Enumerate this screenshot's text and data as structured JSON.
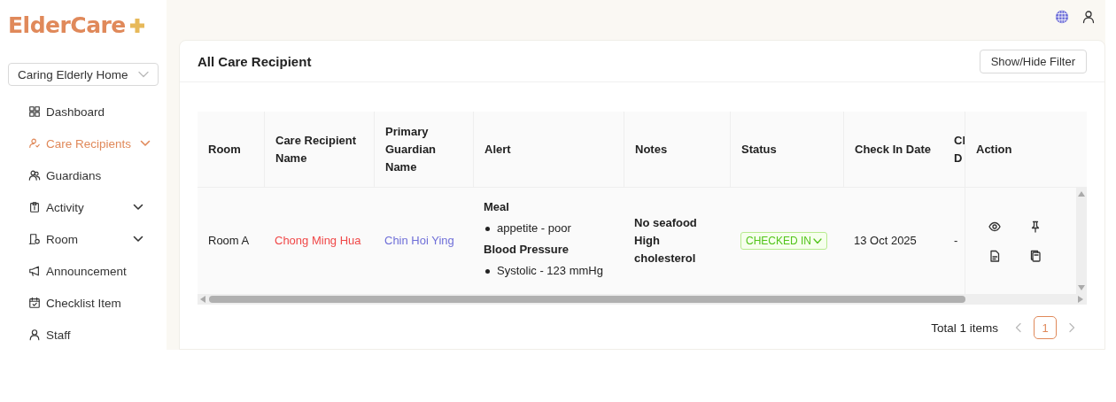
{
  "brand": {
    "name": "ElderCare"
  },
  "home_select": {
    "value": "Caring Elderly Home"
  },
  "sidebar": {
    "items": [
      {
        "label": "Dashboard",
        "selected": false,
        "submenu": false
      },
      {
        "label": "Care Recipients",
        "selected": true,
        "submenu": true
      },
      {
        "label": "Guardians",
        "selected": false,
        "submenu": false
      },
      {
        "label": "Activity",
        "selected": false,
        "submenu": true
      },
      {
        "label": "Room",
        "selected": false,
        "submenu": true
      },
      {
        "label": "Announcement",
        "selected": false,
        "submenu": false
      },
      {
        "label": "Checklist Item",
        "selected": false,
        "submenu": false
      },
      {
        "label": "Staff",
        "selected": false,
        "submenu": false
      }
    ]
  },
  "card": {
    "title": "All Care Recipient",
    "filter_button": "Show/Hide Filter"
  },
  "table": {
    "columns": [
      "Room",
      "Care Recipient Name",
      "Primary Guardian Name",
      "Alert",
      "Notes",
      "Status",
      "Check In Date",
      "Cl D",
      "Action"
    ],
    "rows": [
      {
        "room": "Room A",
        "name": "Chong Ming Hua",
        "guardian": "Chin Hoi Ying",
        "alerts": [
          {
            "title": "Meal",
            "items": [
              "appetite - poor"
            ]
          },
          {
            "title": "Blood Pressure",
            "items": [
              "Systolic - 123 mmHg"
            ]
          }
        ],
        "notes": [
          "No seafood",
          "High cholesterol"
        ],
        "status": {
          "label": "CHECKED IN",
          "kind": "checked_in"
        },
        "check_in_date": "13 Oct 2025",
        "column_8": "-"
      }
    ]
  },
  "pagination": {
    "total": "Total 1 items",
    "pages": [
      {
        "label": "1",
        "selected": true
      }
    ]
  }
}
